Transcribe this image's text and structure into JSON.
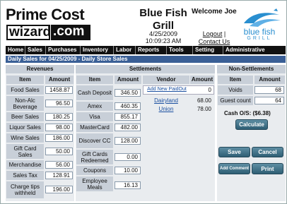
{
  "logo": {
    "line1": "Prime Cost",
    "wizard": "wizard",
    "com": ".com"
  },
  "store": {
    "name": "Blue Fish Grill",
    "date": "4/25/2009",
    "time": "10:09:23 AM"
  },
  "welcome": "Welcome Joe",
  "links": {
    "logout": "Logout",
    "separator": "|",
    "contact": "Contact Us"
  },
  "brand_logo": {
    "text": "blue fish",
    "subtext": "GRILL",
    "color": "#2a8fd0"
  },
  "nav": [
    "Home",
    "Sales",
    "Purchases",
    "Inventory",
    "Labor",
    "Reports",
    "Tools",
    "Setting",
    "Administrative"
  ],
  "subtitle": "Daily Sales for 04/25/2009 - Daily Store Sales",
  "revenues": {
    "title": "Revenues",
    "item_header": "Item",
    "amount_header": "Amount",
    "rows": [
      {
        "item": "Food Sales",
        "amount": "1458.87"
      },
      {
        "item": "Non-Alc Beverage",
        "amount": "96.50"
      },
      {
        "item": "Beer Sales",
        "amount": "180.25"
      },
      {
        "item": "Liquor Sales",
        "amount": "98.00"
      },
      {
        "item": "Wine Sales",
        "amount": "186.00"
      },
      {
        "item": "Gift Card Sales",
        "amount": "50.00"
      },
      {
        "item": "Merchandise",
        "amount": "56.00"
      },
      {
        "item": "Sales Tax",
        "amount": "128.91"
      },
      {
        "item": "Charge tips withheld",
        "amount": "196.00"
      }
    ]
  },
  "settlements": {
    "title": "Settlements",
    "item_header": "Item",
    "amount_header": "Amount",
    "rows": [
      {
        "item": "Cash Deposit",
        "amount": "346.50"
      },
      {
        "item": "Amex",
        "amount": "460.35"
      },
      {
        "item": "Visa",
        "amount": "855.17"
      },
      {
        "item": "MasterCard",
        "amount": "482.00"
      },
      {
        "item": "Discover CC",
        "amount": "128.00"
      },
      {
        "item": "Gift Cards Redeemed",
        "amount": "0.00"
      },
      {
        "item": "Coupons",
        "amount": "10.00"
      },
      {
        "item": "Employee Meals",
        "amount": "16.13"
      }
    ],
    "vendor_header": "Vendor",
    "vendor_amount_header": "Amount",
    "add_paidout": "Add New PaidOut",
    "add_paidout_amount": "0",
    "vendors": [
      {
        "name": "Dairyland",
        "amount": "68.00"
      },
      {
        "name": "Union",
        "amount": "78.00"
      }
    ]
  },
  "non_settlements": {
    "title": "Non-Settlements",
    "item_header": "Item",
    "amount_header": "Amount",
    "rows": [
      {
        "item": "Voids",
        "amount": "68"
      },
      {
        "item": "Guest count",
        "amount": "64"
      }
    ],
    "cash_os": "Cash O/S: ($6.38)"
  },
  "buttons": {
    "calculate": "Calculate",
    "save": "Save",
    "cancel": "Cancel",
    "add_comment": "Add Comment",
    "print": "Print"
  }
}
